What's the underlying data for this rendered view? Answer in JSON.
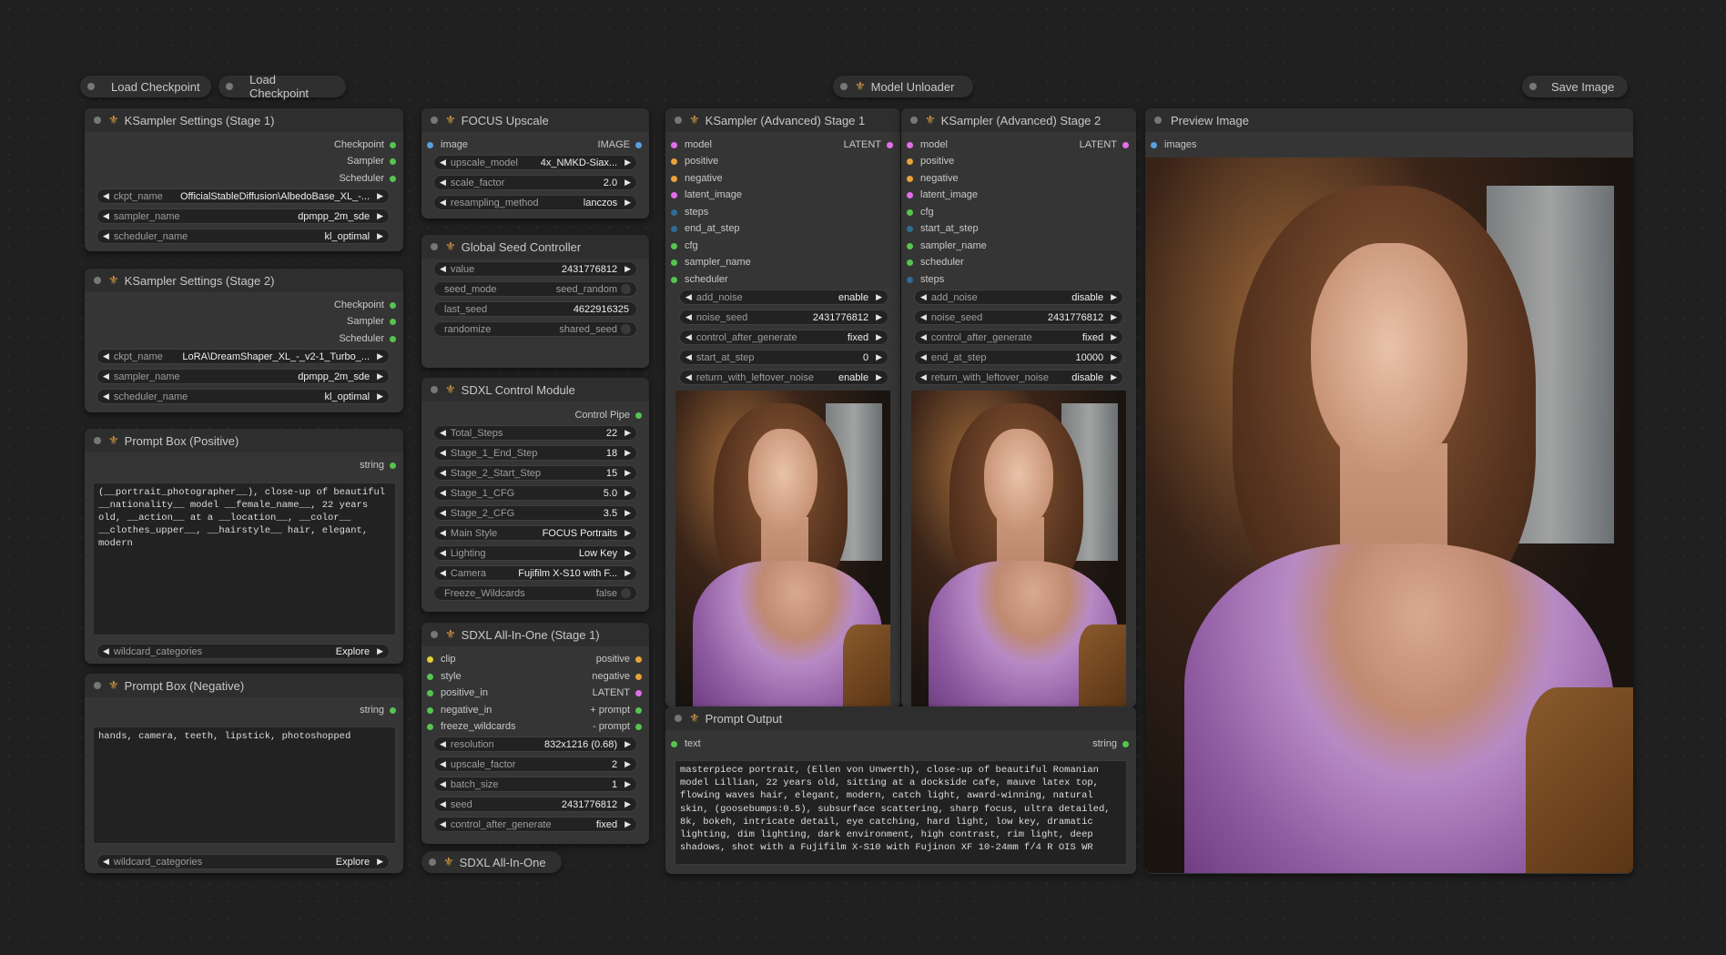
{
  "collapsed": {
    "load_checkpoint_1": "Load Checkpoint",
    "load_checkpoint_2": "Load Checkpoint",
    "model_unloader": "Model Unloader",
    "save_image": "Save Image",
    "sdxl_all_in_one": "SDXL All-In-One"
  },
  "ks1": {
    "title": "KSampler Settings (Stage 1)",
    "outputs": [
      "Checkpoint",
      "Sampler",
      "Scheduler"
    ],
    "ckpt_label": "ckpt_name",
    "ckpt_value": "OfficialStableDiffusion\\AlbedoBase_XL_-...",
    "sampler_label": "sampler_name",
    "sampler_value": "dpmpp_2m_sde",
    "scheduler_label": "scheduler_name",
    "scheduler_value": "kl_optimal"
  },
  "ks2": {
    "title": "KSampler Settings (Stage 2)",
    "outputs": [
      "Checkpoint",
      "Sampler",
      "Scheduler"
    ],
    "ckpt_label": "ckpt_name",
    "ckpt_value": "LoRA\\DreamShaper_XL_-_v2-1_Turbo_...",
    "sampler_label": "sampler_name",
    "sampler_value": "dpmpp_2m_sde",
    "scheduler_label": "scheduler_name",
    "scheduler_value": "kl_optimal"
  },
  "prompt_pos": {
    "title": "Prompt Box (Positive)",
    "output": "string",
    "text": "(__portrait_photographer__), close-up of beautiful __nationality__ model __female_name__, 22 years old, __action__ at a __location__, __color__ __clothes_upper__, __hairstyle__ hair, elegant, modern",
    "wildcard_label": "wildcard_categories",
    "wildcard_value": "Explore"
  },
  "prompt_neg": {
    "title": "Prompt Box (Negative)",
    "output": "string",
    "text": "hands, camera, teeth, lipstick, photoshopped",
    "wildcard_label": "wildcard_categories",
    "wildcard_value": "Explore"
  },
  "upscale": {
    "title": "FOCUS Upscale",
    "input": "image",
    "output": "IMAGE",
    "model_label": "upscale_model",
    "model_value": "4x_NMKD-Siax...",
    "scale_label": "scale_factor",
    "scale_value": "2.0",
    "method_label": "resampling_method",
    "method_value": "lanczos"
  },
  "seed": {
    "title": "Global Seed Controller",
    "value_label": "value",
    "value_value": "2431776812",
    "mode_label": "seed_mode",
    "mode_value": "seed_random",
    "last_label": "last_seed",
    "last_value": "4622916325",
    "rand_label": "randomize",
    "rand_value": "shared_seed"
  },
  "control": {
    "title": "SDXL Control Module",
    "output": "Control Pipe",
    "widgets": [
      {
        "label": "Total_Steps",
        "value": "22"
      },
      {
        "label": "Stage_1_End_Step",
        "value": "18"
      },
      {
        "label": "Stage_2_Start_Step",
        "value": "15"
      },
      {
        "label": "Stage_1_CFG",
        "value": "5.0"
      },
      {
        "label": "Stage_2_CFG",
        "value": "3.5"
      },
      {
        "label": "Main Style",
        "value": "FOCUS Portraits"
      },
      {
        "label": "Lighting",
        "value": "Low Key"
      },
      {
        "label": "Camera",
        "value": "Fujifilm X-S10 with F..."
      }
    ],
    "freeze_label": "Freeze_Wildcards",
    "freeze_value": "false"
  },
  "aio": {
    "title": "SDXL All-In-One (Stage 1)",
    "inputs": [
      "clip",
      "style",
      "positive_in",
      "negative_in",
      "freeze_wildcards"
    ],
    "outputs": [
      "positive",
      "negative",
      "LATENT",
      "+ prompt",
      "- prompt"
    ],
    "widgets": [
      {
        "label": "resolution",
        "value": "832x1216 (0.68)"
      },
      {
        "label": "upscale_factor",
        "value": "2"
      },
      {
        "label": "batch_size",
        "value": "1"
      },
      {
        "label": "seed",
        "value": "2431776812"
      },
      {
        "label": "control_after_generate",
        "value": "fixed"
      }
    ]
  },
  "ksa1": {
    "title": "KSampler (Advanced) Stage 1",
    "inputs": [
      "model",
      "positive",
      "negative",
      "latent_image",
      "steps",
      "end_at_step",
      "cfg",
      "sampler_name",
      "scheduler"
    ],
    "output": "LATENT",
    "widgets": [
      {
        "label": "add_noise",
        "value": "enable"
      },
      {
        "label": "noise_seed",
        "value": "2431776812"
      },
      {
        "label": "control_after_generate",
        "value": "fixed"
      },
      {
        "label": "start_at_step",
        "value": "0"
      },
      {
        "label": "return_with_leftover_noise",
        "value": "enable"
      }
    ]
  },
  "ksa2": {
    "title": "KSampler (Advanced) Stage 2",
    "inputs": [
      "model",
      "positive",
      "negative",
      "latent_image",
      "cfg",
      "start_at_step",
      "sampler_name",
      "scheduler",
      "steps"
    ],
    "output": "LATENT",
    "widgets": [
      {
        "label": "add_noise",
        "value": "disable"
      },
      {
        "label": "noise_seed",
        "value": "2431776812"
      },
      {
        "label": "control_after_generate",
        "value": "fixed"
      },
      {
        "label": "end_at_step",
        "value": "10000"
      },
      {
        "label": "return_with_leftover_noise",
        "value": "disable"
      }
    ]
  },
  "prompt_out": {
    "title": "Prompt Output",
    "input": "text",
    "output": "string",
    "text": "masterpiece portrait, (Ellen von Unwerth), close-up of beautiful Romanian model Lillian, 22 years old, sitting at a dockside cafe, mauve latex top, flowing waves hair, elegant, modern, catch light, award-winning, natural skin, (goosebumps:0.5), subsurface scattering, sharp focus, ultra detailed, 8k, bokeh, intricate detail, eye catching, hard light, low key, dramatic lighting, dim lighting, dark environment, high contrast, rim light, deep shadows, shot with a Fujifilm X-S10 with Fujinon XF 10-24mm f/4 R OIS WR"
  },
  "preview": {
    "title": "Preview Image",
    "input": "images"
  },
  "colors": {
    "canvas": "#202020",
    "node_body": "#353535",
    "node_title": "#2e2e2e",
    "widget": "#222222",
    "accent_icon": "#e0a040"
  }
}
